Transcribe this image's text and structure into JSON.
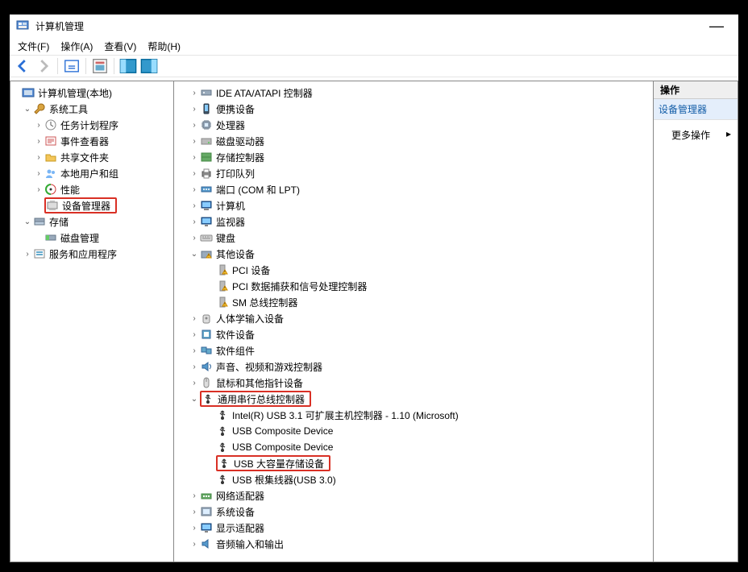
{
  "window": {
    "title": "计算机管理"
  },
  "menu": {
    "file": "文件(F)",
    "action": "操作(A)",
    "view": "查看(V)",
    "help": "帮助(H)"
  },
  "right": {
    "header": "操作",
    "item": "设备管理器",
    "more": "更多操作"
  },
  "left": {
    "root": "计算机管理(本地)",
    "systools": "系统工具",
    "sched": "任务计划程序",
    "event": "事件查看器",
    "shared": "共享文件夹",
    "users": "本地用户和组",
    "perf": "性能",
    "devmgr": "设备管理器",
    "storage": "存储",
    "diskmgr": "磁盘管理",
    "services": "服务和应用程序"
  },
  "center": {
    "ide": "IDE ATA/ATAPI 控制器",
    "portable": "便携设备",
    "cpu": "处理器",
    "diskdrv": "磁盘驱动器",
    "storctrl": "存储控制器",
    "printq": "打印队列",
    "ports": "端口 (COM 和 LPT)",
    "computer": "计算机",
    "monitor": "监视器",
    "keyboard": "键盘",
    "other": "其他设备",
    "pcidev": "PCI 设备",
    "pcidata": "PCI 数据捕获和信号处理控制器",
    "smbus": "SM 总线控制器",
    "hid": "人体学输入设备",
    "softdev": "软件设备",
    "softcomp": "软件组件",
    "sound": "声音、视频和游戏控制器",
    "mouse": "鼠标和其他指针设备",
    "usb": "通用串行总线控制器",
    "usb1": "Intel(R) USB 3.1 可扩展主机控制器 - 1.10 (Microsoft)",
    "usb2": "USB Composite Device",
    "usb3": "USB Composite Device",
    "usb4": "USB 大容量存储设备",
    "usb5": "USB 根集线器(USB 3.0)",
    "netadapt": "网络适配器",
    "sysdev": "系统设备",
    "display": "显示适配器",
    "audioio": "音频输入和输出"
  }
}
